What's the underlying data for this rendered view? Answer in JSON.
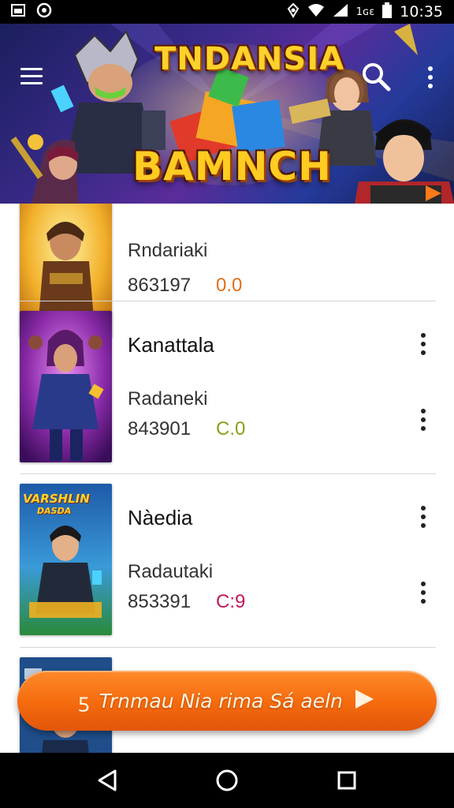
{
  "status_bar": {
    "time": "10:35",
    "carrier_text": "1ɢɛ",
    "icons": [
      "gallery-icon",
      "app-notification-icon",
      "nfc-icon",
      "wifi-icon",
      "signal-icon",
      "battery-icon"
    ]
  },
  "banner": {
    "title_top": "TNDANSIA",
    "title_main": "BAMNCH",
    "icons": {
      "menu": "hamburger-menu-icon",
      "search": "search-icon",
      "more": "more-vert-icon"
    }
  },
  "items": [
    {
      "title": "",
      "subtitle": "Rndariaki",
      "number": "863197",
      "badge": "0.0",
      "badge_color": "#e0701a",
      "art": "golden-warrior"
    },
    {
      "title": "Kanattala",
      "subtitle": "Radaneki",
      "number": "843901",
      "badge": "C.0",
      "badge_color": "#8aa11a",
      "art": "purple-hooded-fighter"
    },
    {
      "title": "Nàedia",
      "subtitle": "Radautaki",
      "number": "853391",
      "badge": "C:9",
      "badge_color": "#c2185b",
      "art": "varsillin-poster",
      "poster_text": "VARSHLIN",
      "poster_sub": "DASDA"
    },
    {
      "title": "",
      "subtitle": "",
      "number": "",
      "badge": "",
      "badge_color": "#333333",
      "art": "blue-warrior"
    }
  ],
  "cta": {
    "lead": "ƽ",
    "label": "Trnmau Nia rima Sá aeln",
    "icon": "play-icon"
  },
  "nav_bar": {
    "icons": [
      "back-icon",
      "home-icon",
      "recents-icon"
    ]
  },
  "colors": {
    "accent_orange": "#f46a0d",
    "banner_title": "#ffd22b",
    "divider": "#d6d6d6"
  }
}
